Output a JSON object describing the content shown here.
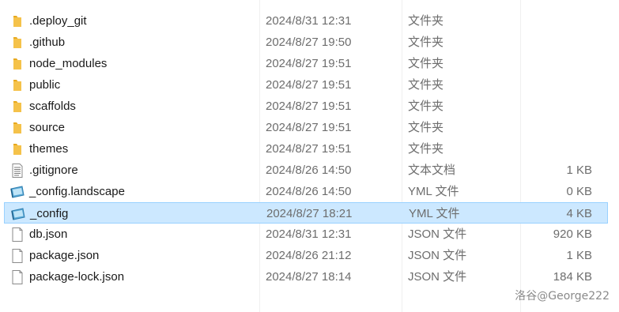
{
  "files": [
    {
      "name": ".deploy_git",
      "date": "2024/8/31 12:31",
      "type": "文件夹",
      "size": "",
      "icon": "folder-icon"
    },
    {
      "name": ".github",
      "date": "2024/8/27 19:50",
      "type": "文件夹",
      "size": "",
      "icon": "folder-icon"
    },
    {
      "name": "node_modules",
      "date": "2024/8/27 19:51",
      "type": "文件夹",
      "size": "",
      "icon": "folder-icon"
    },
    {
      "name": "public",
      "date": "2024/8/27 19:51",
      "type": "文件夹",
      "size": "",
      "icon": "folder-icon"
    },
    {
      "name": "scaffolds",
      "date": "2024/8/27 19:51",
      "type": "文件夹",
      "size": "",
      "icon": "folder-icon"
    },
    {
      "name": "source",
      "date": "2024/8/27 19:51",
      "type": "文件夹",
      "size": "",
      "icon": "folder-icon"
    },
    {
      "name": "themes",
      "date": "2024/8/27 19:51",
      "type": "文件夹",
      "size": "",
      "icon": "folder-icon"
    },
    {
      "name": ".gitignore",
      "date": "2024/8/26 14:50",
      "type": "文本文档",
      "size": "1 KB",
      "icon": "text-file-icon"
    },
    {
      "name": "_config.landscape",
      "date": "2024/8/26 14:50",
      "type": "YML 文件",
      "size": "0 KB",
      "icon": "yml-file-icon"
    },
    {
      "name": "_config",
      "date": "2024/8/27 18:21",
      "type": "YML 文件",
      "size": "4 KB",
      "icon": "yml-file-icon",
      "selected": true
    },
    {
      "name": "db.json",
      "date": "2024/8/31 12:31",
      "type": "JSON 文件",
      "size": "920 KB",
      "icon": "blank-file-icon"
    },
    {
      "name": "package.json",
      "date": "2024/8/26 21:12",
      "type": "JSON 文件",
      "size": "1 KB",
      "icon": "blank-file-icon"
    },
    {
      "name": "package-lock.json",
      "date": "2024/8/27 18:14",
      "type": "JSON 文件",
      "size": "184 KB",
      "icon": "blank-file-icon"
    }
  ],
  "watermark": "洛谷@George222",
  "colors": {
    "folder": "#f5c24a",
    "selection_bg": "#cce8ff",
    "selection_border": "#99d1ff"
  }
}
